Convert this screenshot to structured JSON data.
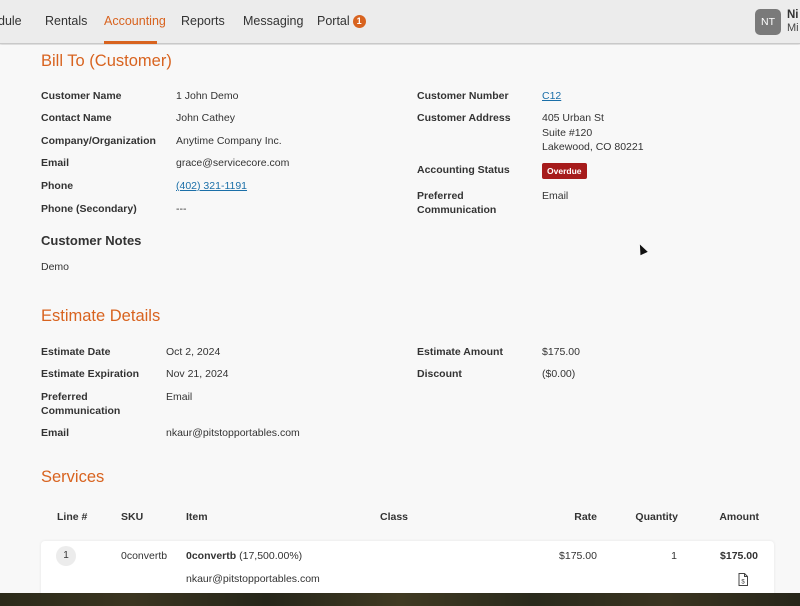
{
  "nav": {
    "items": [
      {
        "label": "dule"
      },
      {
        "label": "Rentals"
      },
      {
        "label": "Accounting"
      },
      {
        "label": "Reports"
      },
      {
        "label": "Messaging"
      },
      {
        "label": "Portal",
        "badge": "1"
      }
    ],
    "active": "Accounting",
    "user": {
      "initials": "NT",
      "name": "Ni",
      "sub": "Mi"
    }
  },
  "bill_to": {
    "title": "Bill To (Customer)",
    "left": [
      {
        "label": "Customer Name",
        "value": "1 John Demo"
      },
      {
        "label": "Contact Name",
        "value": "John Cathey"
      },
      {
        "label": "Company/Organization",
        "value": "Anytime Company Inc."
      },
      {
        "label": "Email",
        "value": "grace@servicecore.com"
      },
      {
        "label": "Phone",
        "value": "(402) 321-1191"
      },
      {
        "label": "Phone (Secondary)",
        "value": "---"
      }
    ],
    "customer_number": {
      "label": "Customer Number",
      "value": "C12"
    },
    "customer_address": {
      "label": "Customer Address",
      "line1": "405 Urban St",
      "line2": "Suite #120",
      "line3": "Lakewood, CO 80221"
    },
    "accounting_status": {
      "label": "Accounting Status",
      "value": "Overdue"
    },
    "preferred_communication": {
      "label_line1": "Preferred",
      "label_line2": "Communication",
      "value": "Email"
    },
    "notes_title": "Customer Notes",
    "notes": "Demo"
  },
  "estimate": {
    "title": "Estimate Details",
    "date": {
      "label": "Estimate Date",
      "value": "Oct 2, 2024"
    },
    "expiration": {
      "label": "Estimate Expiration",
      "value": "Nov 21, 2024"
    },
    "preferred_communication": {
      "label_line1": "Preferred",
      "label_line2": "Communication",
      "value": "Email"
    },
    "email": {
      "label": "Email",
      "value": "nkaur@pitstopportables.com"
    },
    "amount": {
      "label": "Estimate Amount",
      "value": "$175.00"
    },
    "discount": {
      "label": "Discount",
      "value": "($0.00)"
    }
  },
  "services": {
    "title": "Services",
    "headers": {
      "line": "Line #",
      "sku": "SKU",
      "item": "Item",
      "class": "Class",
      "rate": "Rate",
      "quantity": "Quantity",
      "amount": "Amount"
    },
    "rows": [
      {
        "line": "1",
        "sku": "0convertb",
        "item_name": "0convertb",
        "item_pct": "(17,500.00%)",
        "item_email": "nkaur@pitstopportables.com",
        "rate": "$175.00",
        "quantity": "1",
        "amount": "$175.00"
      }
    ]
  },
  "colors": {
    "accent": "#d8631f",
    "status_overdue": "#a61b1b",
    "link": "#1b6fa8"
  }
}
